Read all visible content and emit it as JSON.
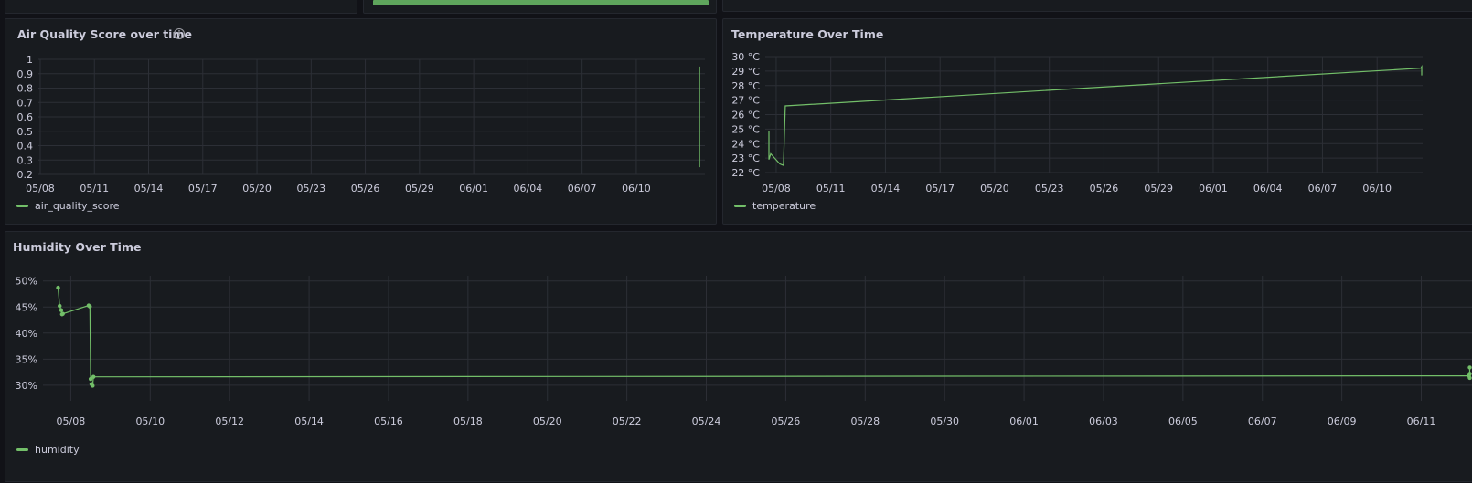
{
  "colors": {
    "series": "#73bf69",
    "grid": "#2c2f36",
    "panel": "#181b1f",
    "bg": "#111217"
  },
  "panels": {
    "air": {
      "title": "Air Quality Score over time",
      "legend": "air_quality_score"
    },
    "temp": {
      "title": "Temperature Over Time",
      "legend": "temperature"
    },
    "hum": {
      "title": "Humidity Over Time",
      "legend": "humidity"
    }
  },
  "chart_data": [
    {
      "type": "line",
      "title": "Air Quality Score over time",
      "legend": "top-left-below",
      "y_ticks": [
        "0.2",
        "0.3",
        "0.4",
        "0.5",
        "0.6",
        "0.7",
        "0.8",
        "0.9",
        "1"
      ],
      "ylim": [
        0.2,
        1
      ],
      "x_ticks": [
        "05/08",
        "05/11",
        "05/14",
        "05/17",
        "05/20",
        "05/23",
        "05/26",
        "05/29",
        "06/01",
        "06/04",
        "06/07",
        "06/10"
      ],
      "xlim_days": [
        -0.1,
        36.8
      ],
      "series": [
        {
          "name": "air_quality_score",
          "x": [
            36.5,
            36.5
          ],
          "y": [
            0.25,
            0.95
          ]
        }
      ]
    },
    {
      "type": "line",
      "title": "Temperature Over Time",
      "y_ticks": [
        "22 °C",
        "23 °C",
        "24 °C",
        "25 °C",
        "26 °C",
        "27 °C",
        "28 °C",
        "29 °C",
        "30 °C"
      ],
      "ylim": [
        22,
        30
      ],
      "x_ticks": [
        "05/08",
        "05/11",
        "05/14",
        "05/17",
        "05/20",
        "05/23",
        "05/26",
        "05/29",
        "06/01",
        "06/04",
        "06/07",
        "06/10"
      ],
      "xlim_days": [
        -0.6,
        35.5
      ],
      "series": [
        {
          "name": "temperature",
          "x": [
            -0.4,
            -0.4,
            -0.3,
            0.2,
            0.4,
            0.5,
            35.4,
            35.45,
            35.45
          ],
          "y": [
            24.9,
            22.9,
            23.3,
            22.6,
            22.5,
            26.6,
            29.2,
            29.3,
            28.7
          ]
        }
      ]
    },
    {
      "type": "line",
      "title": "Humidity Over Time",
      "y_ticks": [
        "30%",
        "35%",
        "40%",
        "45%",
        "50%"
      ],
      "ylim": [
        27,
        51
      ],
      "x_ticks": [
        "05/08",
        "05/10",
        "05/12",
        "05/14",
        "05/16",
        "05/18",
        "05/20",
        "05/22",
        "05/24",
        "05/26",
        "05/28",
        "05/30",
        "06/01",
        "06/03",
        "06/05",
        "06/07",
        "06/09",
        "06/11"
      ],
      "xlim_days": [
        -0.7,
        35.3
      ],
      "series": [
        {
          "name": "humidity",
          "x": [
            -0.32,
            -0.28,
            -0.24,
            -0.22,
            -0.2,
            0.45,
            0.48,
            0.5,
            0.52,
            0.55,
            0.57,
            35.2,
            35.22,
            35.22,
            35.22
          ],
          "y": [
            48.7,
            45.2,
            44.4,
            43.6,
            43.7,
            45.3,
            45.1,
            31.2,
            30.2,
            29.9,
            31.6,
            31.8,
            31.4,
            32.2,
            33.4
          ]
        }
      ]
    }
  ]
}
